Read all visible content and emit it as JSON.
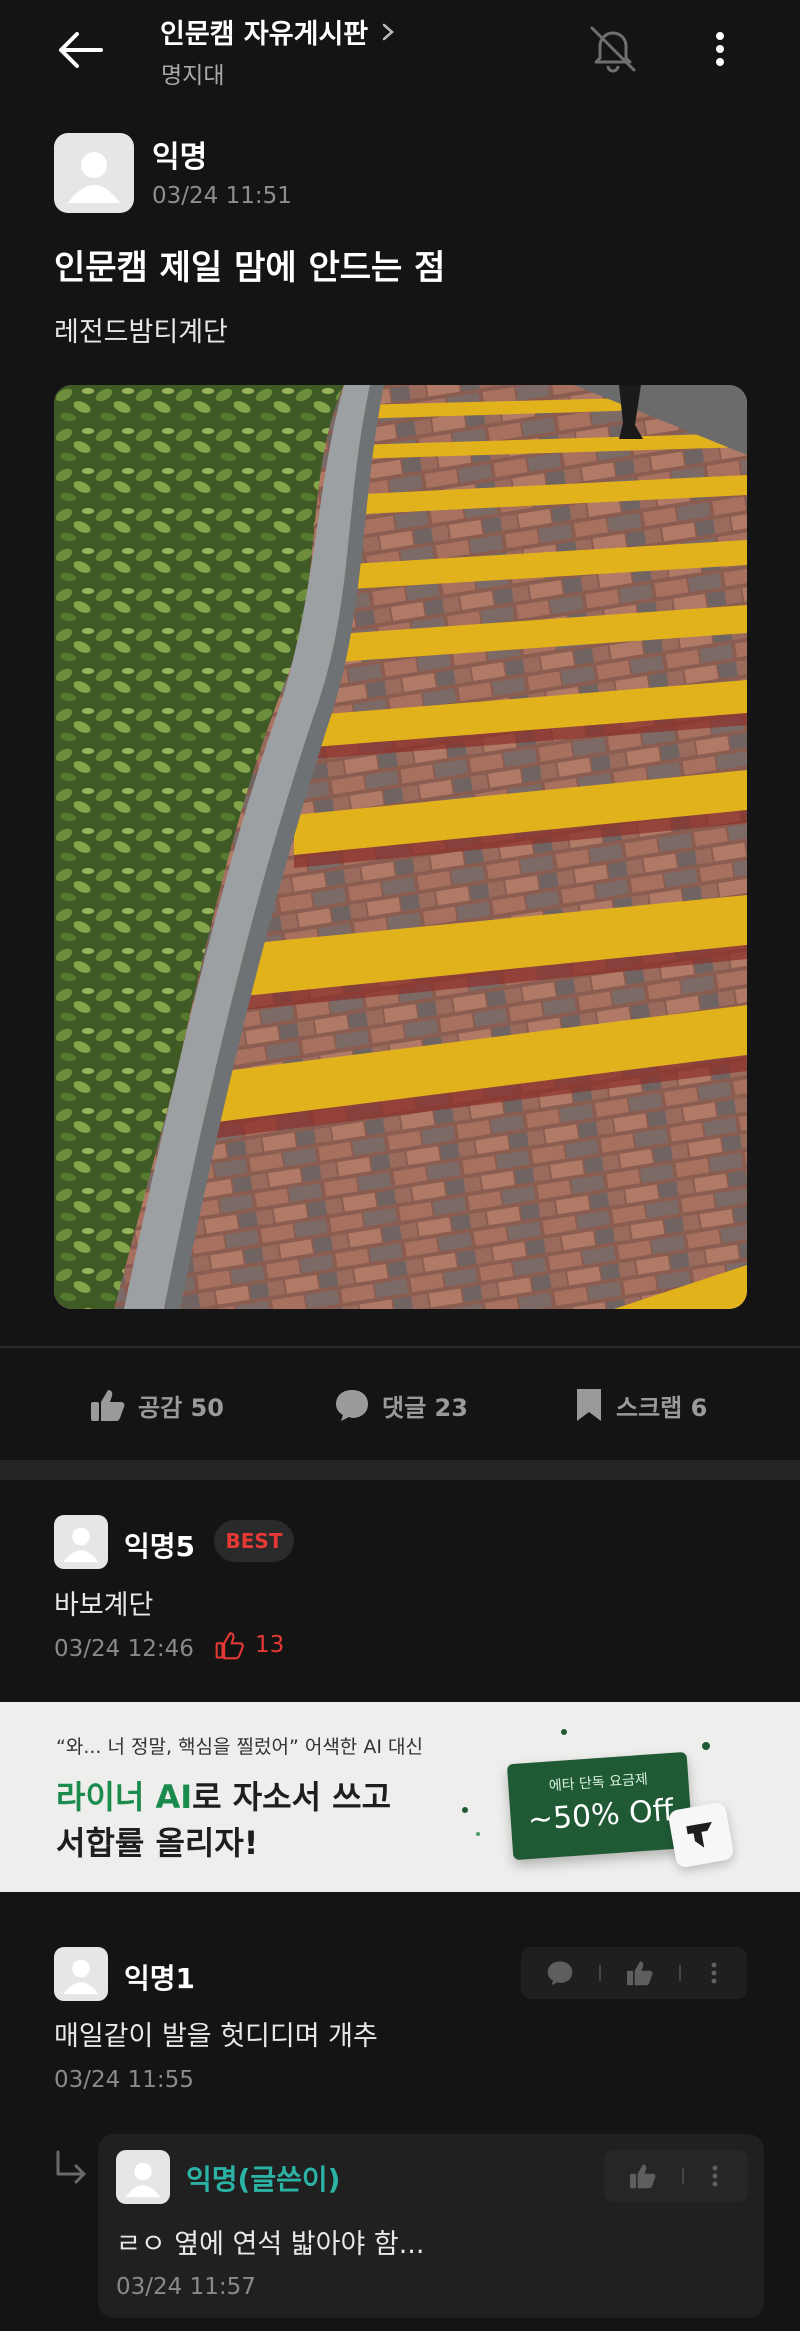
{
  "header": {
    "board_name": "인문캠 자유게시판",
    "school": "명지대",
    "icons": {
      "back": "back-arrow-icon",
      "chevron": "chevron-right-icon",
      "notification": "bell-off-icon",
      "more": "more-vertical-icon"
    }
  },
  "post": {
    "author": "익명",
    "time": "03/24 11:51",
    "title": "인문캠 제일 맘에 안드는 점",
    "body": "레전드밤티계단",
    "image_alt": "노란 줄무늬가 칠해진 벽돌 계단과 옆의 관목 화단 사진"
  },
  "actions": {
    "like_label": "공감 50",
    "comment_label": "댓글 23",
    "scrap_label": "스크랩 6"
  },
  "comments": [
    {
      "author": "익명5",
      "badge": "BEST",
      "text": "바보계단",
      "time": "03/24 12:46",
      "likes": "13"
    },
    {
      "author": "익명1",
      "text": "매일같이 발을 헛디디며 개추",
      "time": "03/24 11:55",
      "replies": [
        {
          "author": "익명(글쓴이)",
          "text": "ㄹㅇ 옆에 연석 밟아야 함...",
          "time": "03/24 11:57"
        }
      ]
    }
  ],
  "ad": {
    "quote": "“와... 너 정말, 핵심을 찔렀어” 어색한 AI 대신",
    "headline_accent": "라이너 AI",
    "headline_rest": "로 자소서 쓰고",
    "headline_line2": "서합률 올리자!",
    "card_small": "에타 단독 요금제",
    "card_big": "~50% Off"
  },
  "colors": {
    "background": "#141414",
    "best_red": "#e53935",
    "author_teal": "#2bb3a5",
    "ad_green": "#1b8a4d"
  }
}
